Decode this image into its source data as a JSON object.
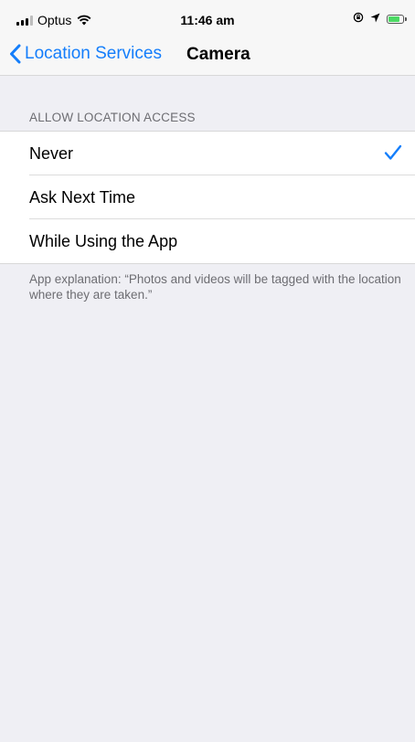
{
  "status_bar": {
    "carrier": "Optus",
    "time": "11:46 am",
    "icons": [
      "signal-icon",
      "wifi-icon",
      "orientation-lock-icon",
      "location-arrow-icon",
      "battery-icon"
    ]
  },
  "nav": {
    "back_label": "Location Services",
    "title": "Camera"
  },
  "section": {
    "header": "ALLOW LOCATION ACCESS",
    "options": [
      {
        "label": "Never",
        "selected": true
      },
      {
        "label": "Ask Next Time",
        "selected": false
      },
      {
        "label": "While Using the App",
        "selected": false
      }
    ],
    "footer": "App explanation: “Photos and videos will be tagged with the location where they are taken.”"
  },
  "colors": {
    "accent": "#147efb",
    "background": "#efeff4",
    "secondary_text": "#6d6d72",
    "battery": "#4cd964"
  }
}
